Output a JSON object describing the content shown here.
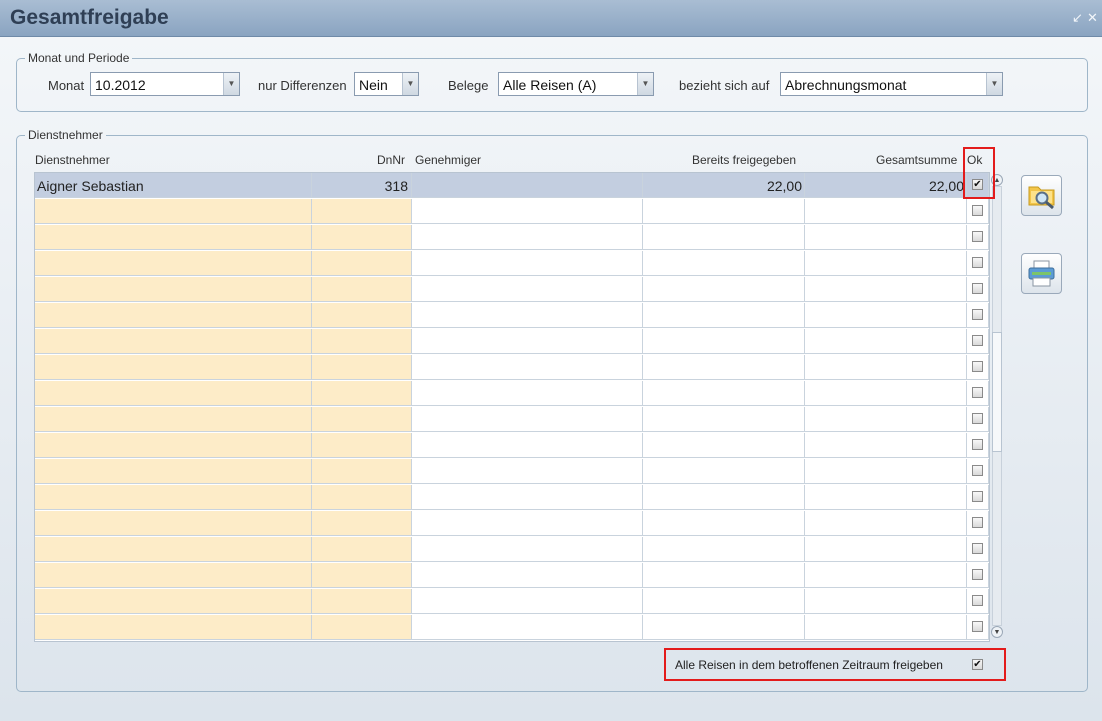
{
  "window": {
    "title": "Gesamtfreigabe"
  },
  "period": {
    "legend": "Monat und Periode",
    "monat_label": "Monat",
    "monat_value": "10.2012",
    "diff_label": "nur Differenzen",
    "diff_value": "Nein",
    "belege_label": "Belege",
    "belege_value": "Alle Reisen (A)",
    "bezieht_label": "bezieht sich auf",
    "bezieht_value": "Abrechnungsmonat"
  },
  "employees": {
    "legend": "Dienstnehmer",
    "columns": [
      "Dienstnehmer",
      "DnNr",
      "Genehmiger",
      "Bereits freigegeben",
      "Gesamtsumme",
      "Ok"
    ],
    "rows": [
      {
        "name": "Aigner Sebastian",
        "dnnr": "318",
        "genehmiger": "",
        "freigegeben": "22,00",
        "gesamt": "22,00",
        "ok": true
      }
    ],
    "empty_rows": 17
  },
  "footer": {
    "release_all_label": "Alle Reisen in dem betroffenen Zeitraum freigeben",
    "release_all_checked": true
  },
  "icons": {
    "minimize": "minimize-icon",
    "close": "close-icon",
    "search": "search-folder-icon",
    "print": "printer-icon"
  }
}
